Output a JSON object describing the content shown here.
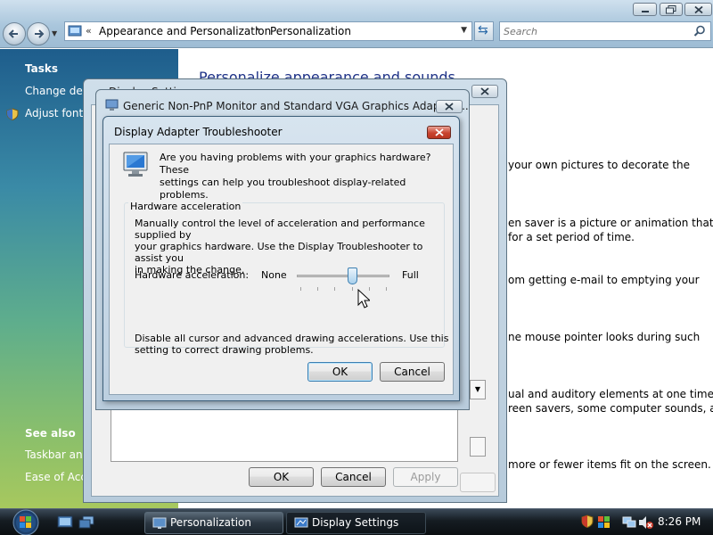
{
  "explorer": {
    "breadcrumb": {
      "back_chevrons": "«",
      "item_1": "Appearance and Personalization",
      "separator": "▸",
      "item_2": "Personalization"
    },
    "search_placeholder": "Search",
    "sidebar": {
      "tasks_heading": "Tasks",
      "tasks": [
        "Change desl",
        "Adjust font s"
      ],
      "see_also_heading": "See also",
      "see_also": [
        "Taskbar and",
        "Ease of Acce"
      ]
    },
    "main": {
      "title": "Personalize appearance and sounds",
      "descriptions": [
        [
          "your own pictures to decorate the"
        ],
        [
          "en saver is a picture or animation that",
          "for a set period of time."
        ],
        [
          "om getting e-mail to emptying your"
        ],
        [
          "ne mouse pointer looks during such"
        ],
        [
          "ual and auditory elements at one time",
          "reen savers, some computer sounds, and"
        ],
        [
          "more or fewer items fit on the screen."
        ]
      ]
    }
  },
  "display_settings": {
    "title": "Display Settings",
    "ok_label": "OK",
    "cancel_label": "Cancel",
    "apply_label": "Apply"
  },
  "adapter_window": {
    "title": "Generic Non-PnP Monitor and Standard VGA Graphics Adapter ..."
  },
  "troubleshooter": {
    "title": "Display Adapter Troubleshooter",
    "intro_line_1": "Are you having problems with your graphics hardware? These",
    "intro_line_2": "settings can help you troubleshoot display-related problems.",
    "group_label": "Hardware acceleration",
    "desc_line_1": "Manually control the level of acceleration and performance supplied by",
    "desc_line_2": "your graphics hardware. Use the Display Troubleshooter to assist you",
    "desc_line_3": "in making the change.",
    "slider_label": "Hardware acceleration:",
    "slider_min_label": "None",
    "slider_max_label": "Full",
    "slider_level": 0.6,
    "slider_ticks": 6,
    "disable_line_1": "Disable all cursor and advanced drawing accelerations. Use this",
    "disable_line_2": "setting to correct drawing problems.",
    "ok_label": "OK",
    "cancel_label": "Cancel"
  },
  "taskbar": {
    "buttons": [
      "Personalization",
      "Display Settings"
    ],
    "clock": "8:26 PM"
  },
  "colors": {
    "title_link_blue": "#1e3287",
    "close_red": "#c9442f",
    "slider_blue": "#3c7fb1"
  }
}
